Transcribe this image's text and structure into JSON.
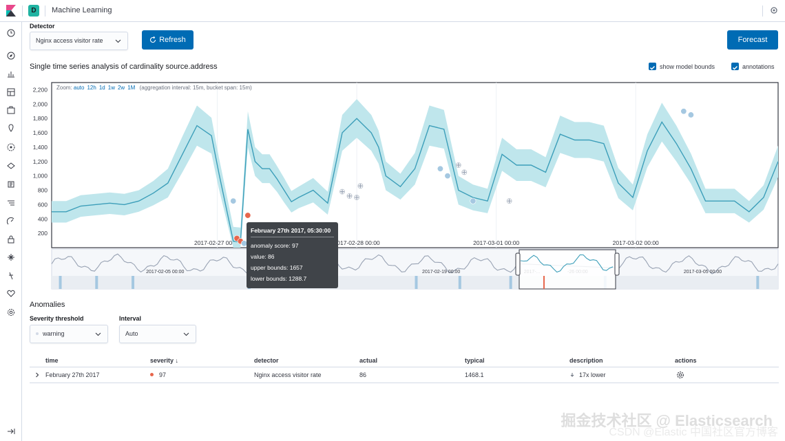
{
  "app": {
    "space_letter": "D",
    "title": "Machine Learning"
  },
  "detector": {
    "label": "Detector",
    "value": "Nginx access visitor rate"
  },
  "buttons": {
    "refresh": "Refresh",
    "forecast": "Forecast"
  },
  "chart_title": "Single time series analysis of cardinality source.address",
  "options": {
    "show_model_bounds": "show model bounds",
    "annotations": "annotations"
  },
  "zoom": {
    "prefix": "Zoom:",
    "levels": [
      "auto",
      "12h",
      "1d",
      "1w",
      "2w",
      "1M"
    ],
    "note": "(aggregation interval: 15m, bucket span: 15m)"
  },
  "chart_data": {
    "type": "line",
    "y_ticks": [
      "2,200",
      "2,000",
      "1,800",
      "1,600",
      "1,400",
      "1,200",
      "1,000",
      "800",
      "600",
      "400",
      "200"
    ],
    "x_ticks": [
      "2017-02-27 00:00",
      "2017-02-28 00:00",
      "2017-03-01 00:00",
      "2017-03-02 00:00"
    ],
    "ylim": [
      0,
      2300
    ],
    "x_range": [
      0,
      100
    ],
    "series": [
      {
        "x": [
          0,
          2,
          4,
          6,
          8,
          10,
          12,
          14,
          16,
          18,
          20,
          22,
          23,
          25,
          26,
          27,
          28,
          29,
          30,
          31,
          32,
          33,
          34,
          36,
          38,
          40,
          42,
          44,
          45,
          46,
          48,
          50,
          52,
          54,
          56,
          58,
          60,
          62,
          64,
          66,
          68,
          70,
          72,
          74,
          76,
          78,
          80,
          82,
          84,
          86,
          88,
          90,
          92,
          94,
          96,
          98,
          100
        ],
        "y": [
          500,
          500,
          580,
          600,
          620,
          600,
          650,
          760,
          900,
          1300,
          1700,
          1560,
          1050,
          90,
          80,
          1650,
          1200,
          1100,
          1100,
          960,
          800,
          640,
          700,
          800,
          620,
          1600,
          1800,
          1600,
          1400,
          1000,
          850,
          1100,
          1700,
          1650,
          800,
          700,
          650,
          1300,
          1150,
          1150,
          1050,
          1580,
          1500,
          1500,
          1450,
          900,
          700,
          1350,
          1750,
          1450,
          1100,
          650,
          650,
          650,
          500,
          700,
          1200
        ],
        "band": [
          150,
          150,
          150,
          150,
          150,
          150,
          150,
          170,
          200,
          250,
          280,
          250,
          220,
          200,
          200,
          250,
          200,
          200,
          200,
          180,
          170,
          150,
          150,
          170,
          160,
          250,
          270,
          250,
          230,
          200,
          180,
          220,
          280,
          270,
          200,
          180,
          170,
          230,
          220,
          220,
          210,
          260,
          250,
          250,
          250,
          210,
          180,
          230,
          270,
          250,
          210,
          170,
          170,
          170,
          150,
          170,
          220
        ]
      }
    ],
    "anomalies": [
      {
        "x": 25.0,
        "y": 650,
        "severity": "low"
      },
      {
        "x": 25.5,
        "y": 130,
        "severity": "critical"
      },
      {
        "x": 26.0,
        "y": 90,
        "severity": "critical"
      },
      {
        "x": 26.5,
        "y": 60,
        "severity": "low"
      },
      {
        "x": 27.0,
        "y": 450,
        "severity": "critical"
      },
      {
        "x": 53.5,
        "y": 1100,
        "severity": "low"
      },
      {
        "x": 54.5,
        "y": 1000,
        "severity": "low"
      },
      {
        "x": 58.0,
        "y": 650,
        "severity": "low"
      },
      {
        "x": 87.0,
        "y": 1900,
        "severity": "low"
      },
      {
        "x": 88.0,
        "y": 1850,
        "severity": "low"
      }
    ],
    "plus_markers": [
      {
        "x": 40,
        "y": 780
      },
      {
        "x": 41,
        "y": 720
      },
      {
        "x": 42,
        "y": 700
      },
      {
        "x": 42.5,
        "y": 860
      },
      {
        "x": 56,
        "y": 1150
      },
      {
        "x": 56.8,
        "y": 1050
      },
      {
        "x": 63,
        "y": 650
      }
    ]
  },
  "context_chart": {
    "x_ticks": [
      "2017-02-05 00:00",
      "2017-02-12 00:00",
      "2017-02-19 00:00",
      "2017-...",
      "-26 00:00",
      "2017-03-05 00:00"
    ]
  },
  "tooltip": {
    "title": "February 27th 2017, 05:30:00",
    "rows": [
      "anomaly score: 97",
      "value: 86",
      "upper bounds: 1657",
      "lower bounds: 1288.7"
    ]
  },
  "anomalies": {
    "title": "Anomalies",
    "severity_label": "Severity threshold",
    "severity_value": "warning",
    "interval_label": "Interval",
    "interval_value": "Auto",
    "columns": [
      "time",
      "severity",
      "detector",
      "actual",
      "typical",
      "description",
      "actions"
    ],
    "severity_sort": "↓",
    "rows": [
      {
        "time": "February 27th 2017",
        "severity": "97",
        "detector": "Nginx access visitor rate",
        "actual": "86",
        "typical": "1468.1",
        "description": "17x lower"
      }
    ]
  },
  "colors": {
    "accent": "#006bb4",
    "line": "#3c9eb9",
    "band": "#bfe6ec",
    "critical": "#e7664c",
    "low": "#a5c8e1",
    "severity_dot": "#e7664c"
  },
  "watermark": {
    "line1": "掘金技术社区 @ Elasticsearch",
    "line2": "CSDN @Elastic 中国社区官方博客"
  }
}
